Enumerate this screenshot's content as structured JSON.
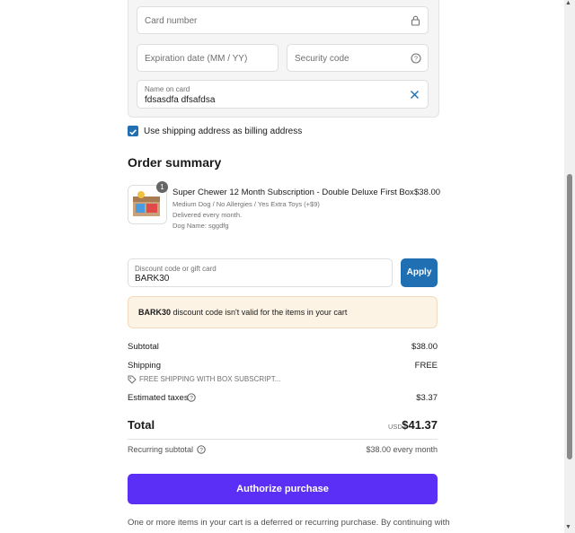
{
  "payment": {
    "card_number_placeholder": "Card number",
    "expiration_placeholder": "Expiration date (MM / YY)",
    "security_placeholder": "Security code",
    "name_label": "Name on card",
    "name_value": "fdsasdfa dfsafdsa"
  },
  "billing": {
    "checkbox_checked": true,
    "checkbox_label": "Use shipping address as billing address"
  },
  "order": {
    "title": "Order summary",
    "item": {
      "quantity": "1",
      "name": "Super Chewer 12 Month Subscription - Double Deluxe First Box",
      "price": "$38.00",
      "variant": "Medium Dog / No Allergies / Yes Extra Toys (+$9)",
      "delivery": "Delivered every month.",
      "dog_name": "Dog Name: sggdfg"
    }
  },
  "discount": {
    "label": "Discount code or gift card",
    "value": "BARK30",
    "apply_label": "Apply",
    "alert_code": "BARK30",
    "alert_text": " discount code isn't valid for the items in your cart"
  },
  "totals": {
    "subtotal_label": "Subtotal",
    "subtotal_value": "$38.00",
    "shipping_label": "Shipping",
    "shipping_value": "FREE",
    "shipping_discount": "FREE SHIPPING WITH BOX SUBSCRIPT...",
    "taxes_label": "Estimated taxes",
    "taxes_value": "$3.37",
    "total_label": "Total",
    "currency": "USD",
    "total_value": "$41.37",
    "recurring_label": "Recurring subtotal",
    "recurring_value": "$38.00 every month"
  },
  "actions": {
    "authorize_label": "Authorize purchase"
  },
  "footer": {
    "notice": "One or more items in your cart is a deferred or recurring purchase. By continuing with"
  },
  "colors": {
    "accent_blue": "#1f6fb2",
    "authorize_purple": "#5b2ff5",
    "alert_bg": "#fdf3e4"
  }
}
